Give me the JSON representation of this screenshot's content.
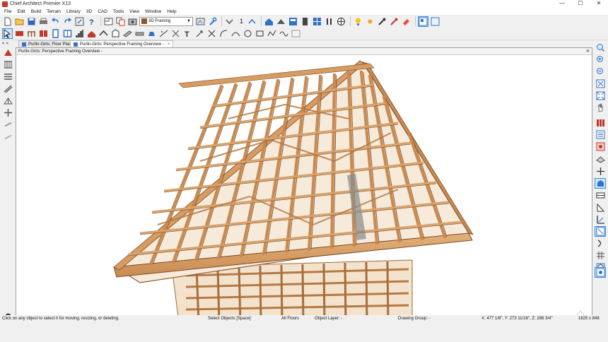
{
  "window": {
    "title": "Chief Architect Premier X13",
    "minimize": "—",
    "maximize": "☐",
    "close": "✕"
  },
  "menu": [
    "File",
    "Edit",
    "Build",
    "Terrain",
    "Library",
    "3D",
    "CAD",
    "Tools",
    "View",
    "Window",
    "Help"
  ],
  "toolbar": {
    "view_dropdown": "3D Framing",
    "floor_number": "1"
  },
  "tabs": [
    {
      "label": "Purlin-Girts: Floor Plan",
      "close": "×"
    },
    {
      "label": "Purlin-Girts: Perspective Framing Overview -",
      "close": "×"
    }
  ],
  "document": {
    "title": "Purlin-Girts: Perspective Framing Overview -",
    "close": "✕"
  },
  "status": {
    "hint": "Click on any object to select it for moving, resizing, or deleting.",
    "mode": "Select Objects [Space]",
    "floor": "All Floors",
    "layer": "Object Layer: -",
    "group": "Drawing Group: -",
    "coords": "X: 477 1/8\", Y: 273 11/16\", Z: 286 3/4\"",
    "size": "1825 x 848"
  },
  "icons": {
    "toolbar_row1": [
      "new-icon",
      "open-icon",
      "save-icon",
      "print-icon",
      "undo-icon",
      "redo-icon",
      "zoom-icon",
      "help-icon",
      "floor-plan-icon",
      "copy-icon",
      "camera-icon",
      "wrench-icon",
      "down-floor-icon",
      "up-floor-icon",
      "house-icon",
      "roof-icon",
      "cabinet-icon",
      "door-icon",
      "window-icon",
      "electrical-icon",
      "light-icon",
      "material-icon",
      "eraser-icon",
      "color-icon",
      "layout-icon"
    ],
    "toolbar_row2": [
      "select-icon",
      "wall-icon",
      "railing-icon",
      "cabinet2-icon",
      "door2-icon",
      "window2-icon",
      "stairs-icon",
      "roof2-icon",
      "dormer-icon",
      "room-icon",
      "framing-icon",
      "slab-icon",
      "camera2-icon",
      "measure-icon",
      "dimension-icon",
      "text-icon",
      "arrow-icon",
      "line-icon",
      "arc-icon",
      "curve-icon",
      "circle-icon",
      "rectangle-icon",
      "polyline-icon",
      "spline-icon",
      "picture-icon"
    ],
    "left": [
      "roof-plane-icon",
      "wall-framing-icon",
      "joist-icon",
      "rafter-icon",
      "truss-icon",
      "post-icon",
      "beam-icon",
      "bracing-icon"
    ],
    "right": [
      "zoom-window-icon",
      "zoom-in-icon",
      "zoom-out-icon",
      "fill-window-icon",
      "fit-icon",
      "pan-icon",
      "library-icon",
      "active-layer-icon",
      "layer-set-icon",
      "display-icon",
      "slab-icon",
      "add-icon",
      "save-camera-icon",
      "walls-icon",
      "triangle-icon",
      "edit-icon",
      "undo-camera-icon",
      "options-icon",
      "grid-icon",
      "orbit-icon",
      "snap-icon"
    ]
  },
  "colors": {
    "accent": "#3d8ee0",
    "wood_light": "#d9a36a",
    "wood_mid": "#b97a42",
    "wood_dark": "#7a4a22"
  }
}
